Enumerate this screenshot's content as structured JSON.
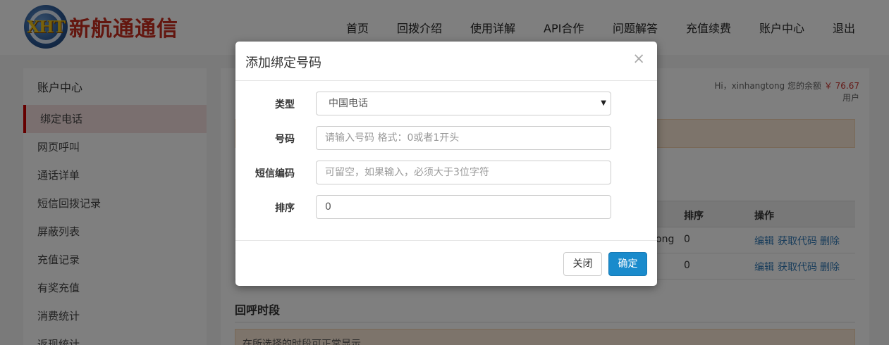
{
  "header": {
    "logo_letters": "XHT",
    "logo_text": "新航通通信",
    "nav": [
      "首页",
      "回拨介绍",
      "使用详解",
      "API合作",
      "问题解答",
      "充值续费",
      "账户中心",
      "退出"
    ]
  },
  "sidebar": {
    "title": "账户中心",
    "items": [
      {
        "label": "绑定电话",
        "active": true
      },
      {
        "label": "网页呼叫"
      },
      {
        "label": "通话详单"
      },
      {
        "label": "短信回拨记录"
      },
      {
        "label": "屏蔽列表"
      },
      {
        "label": "充值记录"
      },
      {
        "label": "有奖充值"
      },
      {
        "label": "消费统计"
      },
      {
        "label": "返现统计"
      }
    ]
  },
  "main": {
    "balance_prefix": "Hi，xinhangtong 您的余额",
    "balance_amount": "￥ 76.67",
    "balance_user": "用户",
    "table": {
      "headers": [
        "排序",
        "操作"
      ],
      "rows": [
        {
          "partial": "ong",
          "order": "0",
          "actions": [
            "编辑",
            "获取代码",
            "删除"
          ]
        },
        {
          "partial": "",
          "order": "0",
          "actions": [
            "编辑",
            "获取代码",
            "删除"
          ]
        }
      ]
    },
    "section_title": "回呼时段",
    "notice": "在所选择的时段可正常显示"
  },
  "modal": {
    "title": "添加绑定号码",
    "close": "×",
    "fields": {
      "type_label": "类型",
      "type_value": "中国电话",
      "number_label": "号码",
      "number_placeholder": "请输入号码 格式：0或者1开头",
      "sms_label": "短信编码",
      "sms_placeholder": "可留空，如果输入，必须大于3位字符",
      "order_label": "排序",
      "order_value": "0"
    },
    "buttons": {
      "close": "关闭",
      "confirm": "确定"
    }
  }
}
